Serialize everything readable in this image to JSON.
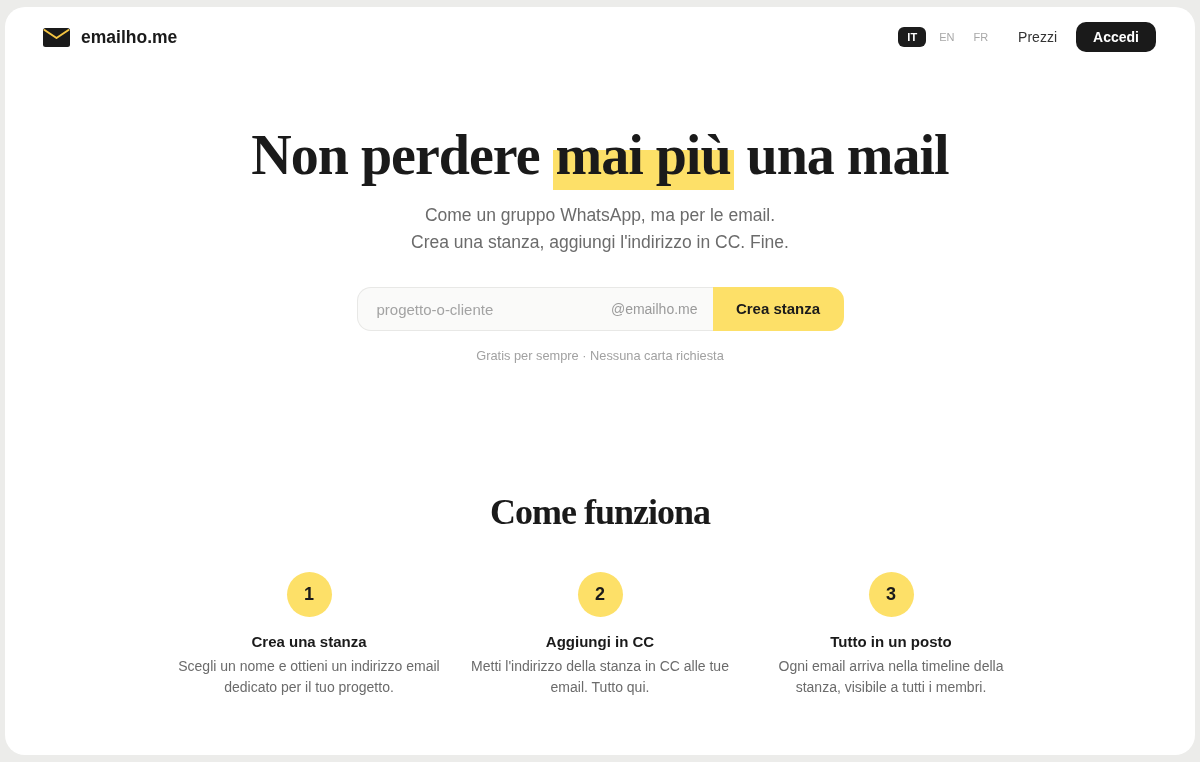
{
  "brand": {
    "name": "emailho.me"
  },
  "nav": {
    "languages": [
      {
        "label": "IT",
        "selected": true
      },
      {
        "label": "EN",
        "selected": false
      },
      {
        "label": "FR",
        "selected": false
      }
    ],
    "links": [
      "Prezzi"
    ],
    "login_button": "Accedi"
  },
  "hero": {
    "headline": {
      "before": "Non perdere",
      "highlight": "mai più",
      "after": "una mail"
    },
    "subtitle_lines": [
      "Come un gruppo WhatsApp, ma per le email.",
      "Crea una stanza, aggiungi l'indirizzo in CC. Fine."
    ],
    "form": {
      "placeholder": "progetto-o-cliente",
      "domain_suffix": "@emailho.me",
      "button": "Crea stanza"
    },
    "note": "Gratis per sempre · Nessuna carta richiesta"
  },
  "how_it_works": {
    "title": "Come funziona",
    "steps": [
      {
        "number": "1",
        "title": "Crea una stanza",
        "description": "Scegli un nome e ottieni un indirizzo email dedicato per il tuo progetto."
      },
      {
        "number": "2",
        "title": "Aggiungi in CC",
        "description": "Metti l'indirizzo della stanza in CC alle tue email. Tutto qui."
      },
      {
        "number": "3",
        "title": "Tutto in un posto",
        "description": "Ogni email arriva nella timeline della stanza, visibile a tutti i membri."
      }
    ]
  }
}
